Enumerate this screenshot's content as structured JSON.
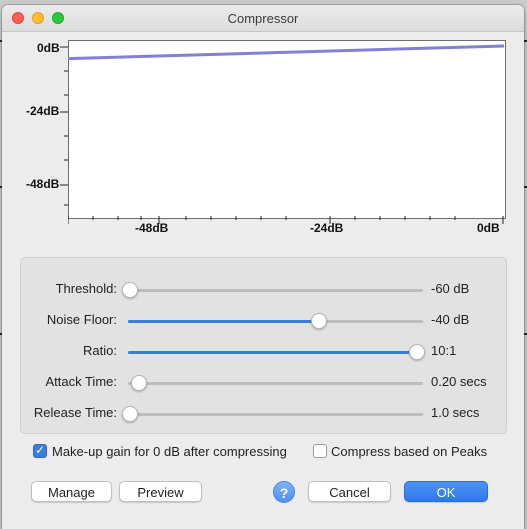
{
  "window": {
    "title": "Compressor"
  },
  "graph": {
    "y_labels": [
      "0dB",
      "-24dB",
      "-48dB"
    ],
    "x_labels": [
      "-48dB",
      "-24dB",
      "0dB"
    ],
    "curve_color": "#8080d8",
    "curve_start_y_db": -6,
    "curve_end_y_db": 0
  },
  "controls": [
    {
      "label": "Threshold:",
      "value": "-60 dB",
      "position": 0.0,
      "filled": false
    },
    {
      "label": "Noise Floor:",
      "value": "-40 dB",
      "position": 0.66,
      "filled": true
    },
    {
      "label": "Ratio:",
      "value": "10:1",
      "position": 1.0,
      "filled": true
    },
    {
      "label": "Attack Time:",
      "value": "0.20 secs",
      "position": 0.03,
      "filled": false
    },
    {
      "label": "Release Time:",
      "value": "1.0 secs",
      "position": 0.0,
      "filled": false
    }
  ],
  "options": {
    "makeup_gain": {
      "label": "Make-up gain for 0 dB after compressing",
      "checked": true
    },
    "compress_peaks": {
      "label": "Compress based on Peaks",
      "checked": false
    }
  },
  "buttons": {
    "manage": "Manage",
    "preview": "Preview",
    "help": "?",
    "cancel": "Cancel",
    "ok": "OK"
  },
  "colors": {
    "accent": "#3b7ce0",
    "primary_button": "#2f78ec"
  }
}
